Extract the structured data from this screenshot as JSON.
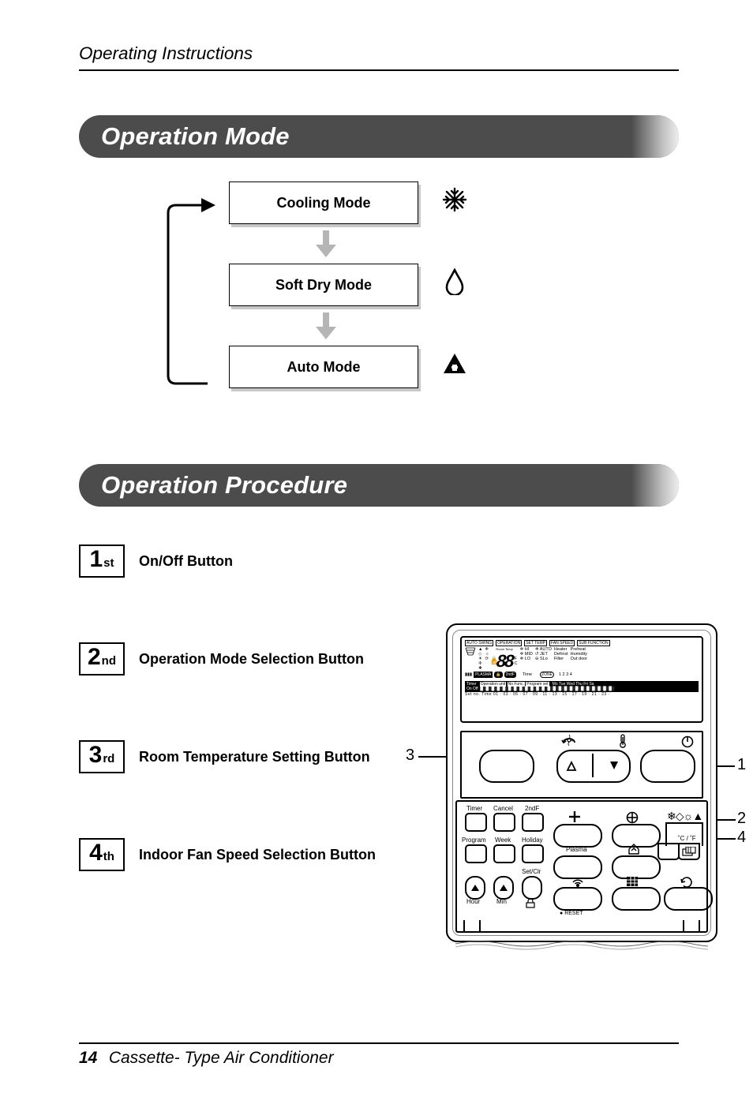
{
  "header": {
    "breadcrumb": "Operating Instructions"
  },
  "section1": {
    "title": "Operation Mode"
  },
  "modes": {
    "cooling": "Cooling Mode",
    "softdry": "Soft Dry Mode",
    "auto": "Auto Mode"
  },
  "section2": {
    "title": "Operation Procedure"
  },
  "steps": [
    {
      "num": "1",
      "suffix": "st",
      "label": "On/Off Button"
    },
    {
      "num": "2",
      "suffix": "nd",
      "label": "Operation Mode Selection Button"
    },
    {
      "num": "3",
      "suffix": "rd",
      "label": "Room Temperature Setting Button"
    },
    {
      "num": "4",
      "suffix": "th",
      "label": "Indoor Fan Speed Selection Button"
    }
  ],
  "callouts": {
    "c1": "1",
    "c2": "2",
    "c3": "3",
    "c4": "4"
  },
  "lcd": {
    "badges": [
      "AUTO SWING",
      "OPERATION",
      "SET TEMP",
      "FAN SPEED",
      "SUB FUNCTION"
    ],
    "roomTemp": "Room Temp",
    "temp": "88",
    "fanLines": [
      "HI",
      "MID",
      "LO"
    ],
    "autoCol": [
      "AUTO",
      "JET",
      "SLo"
    ],
    "subCol1": [
      "Heater",
      "Defrost",
      "Filter"
    ],
    "subCol2": [
      "Preheat",
      "Humidity",
      "Out door"
    ],
    "time": "Time",
    "zone": "ZONE",
    "zoneNums": "1  2  3  4",
    "plasma": "PLASMA",
    "secondF_lcd": "2ndF",
    "timer": "Timer",
    "onoff": "On    Off",
    "opUnit": "Operation unit",
    "noFunc": "No Func.",
    "progSet": "Program set",
    "days": "Mo Tue Wed Thu Fri Sa",
    "setno": "Set no.   Time    01  ·  03  ·  05  ·  07  ·  09  ·  11  ·  13  ·  15  ·  17  ·  19  ·  21  ·  23  ·"
  },
  "cover": {
    "timer": "Timer",
    "cancel": "Cancel",
    "secondF": "2ndF",
    "program": "Program",
    "week": "Week",
    "holiday": "Holiday",
    "hour": "Hour",
    "min": "Min",
    "setClr": "Set/Clr",
    "plasma": "Plasma",
    "reset": "RESET",
    "cf": "˚C / ˚F"
  },
  "footer": {
    "page": "14",
    "title": "Cassette- Type Air Conditioner"
  }
}
